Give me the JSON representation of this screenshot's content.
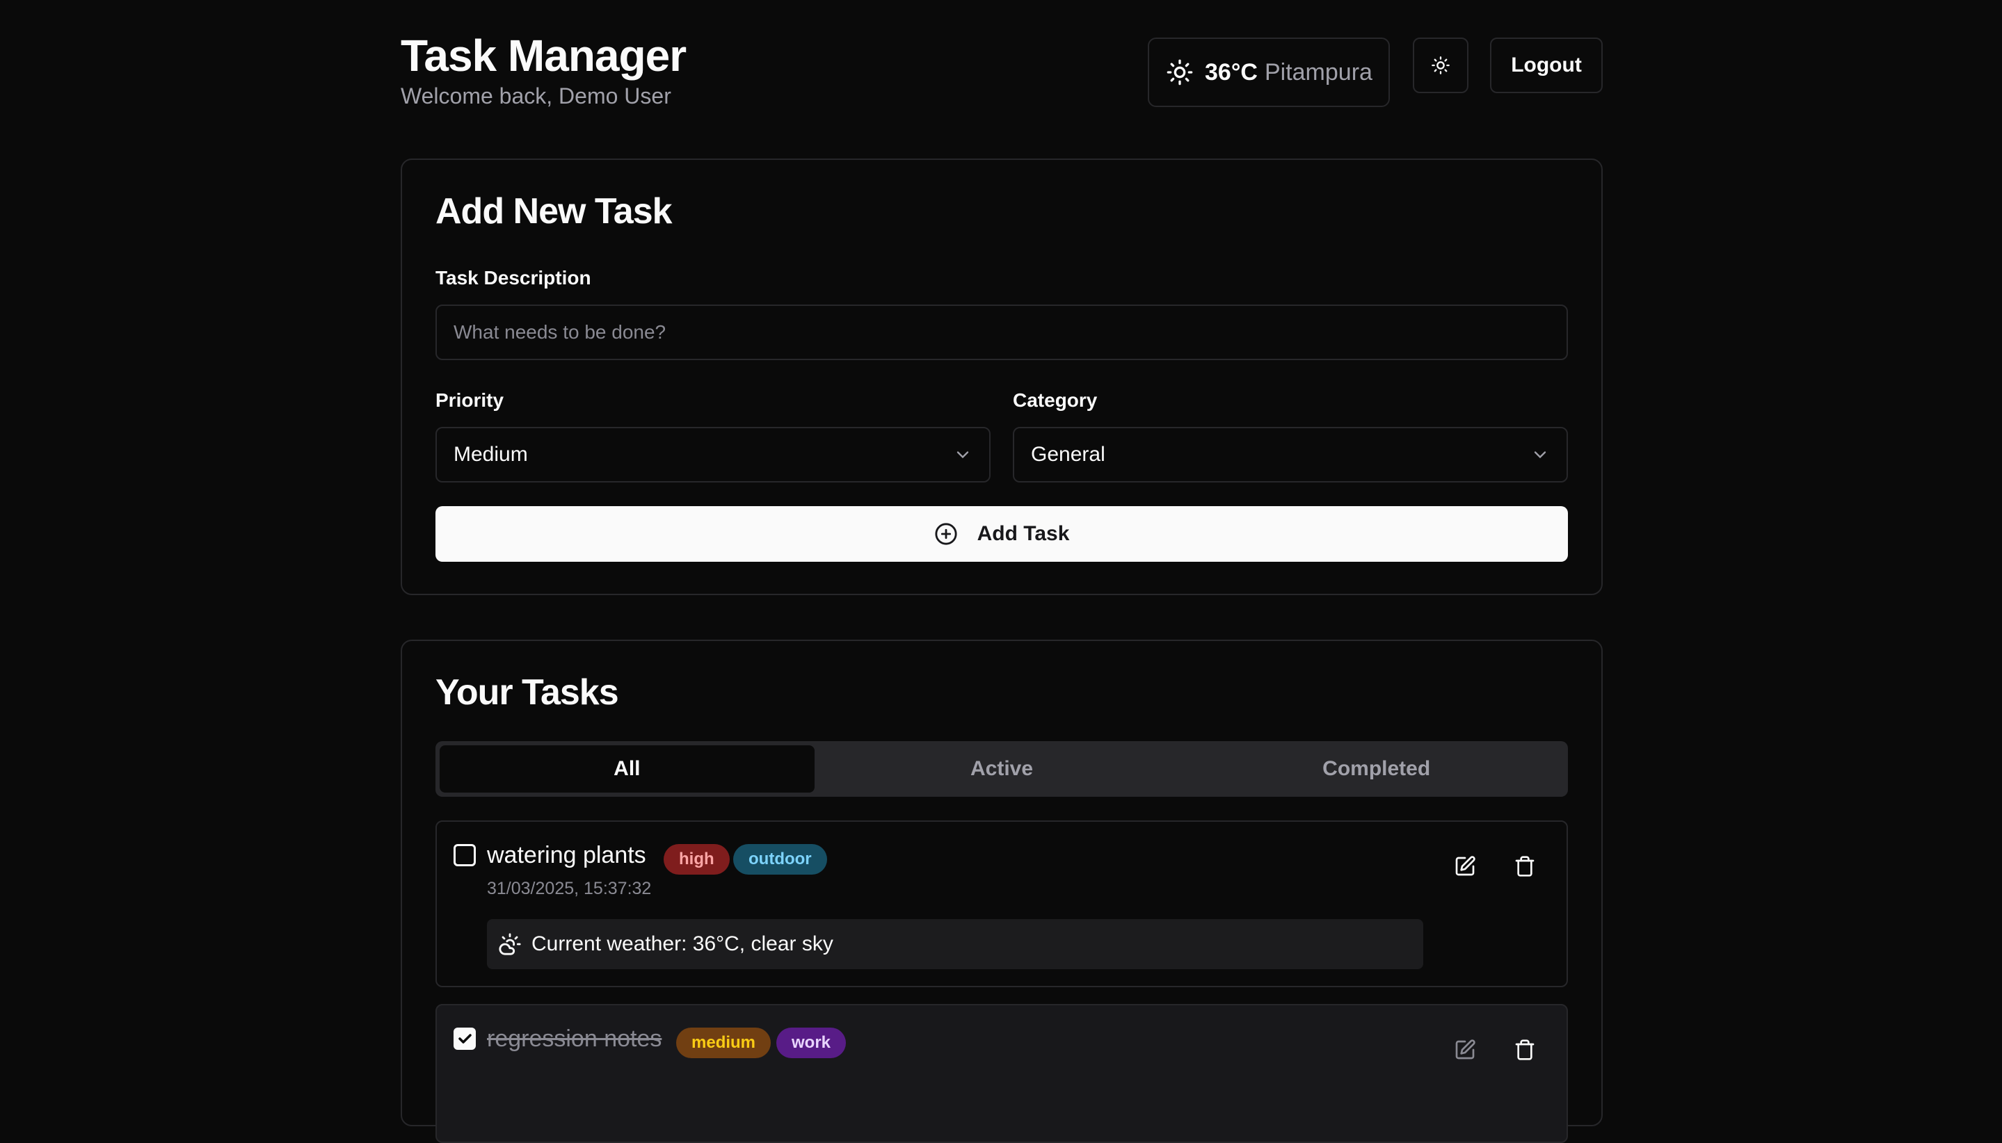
{
  "header": {
    "title": "Task Manager",
    "welcome": "Welcome back, Demo User",
    "weather": {
      "temp": "36°C",
      "city": "Pitampura",
      "icon": "sun-icon"
    },
    "theme_toggle_icon": "sun-icon",
    "logout_label": "Logout"
  },
  "add_task": {
    "title": "Add New Task",
    "description_label": "Task Description",
    "description_placeholder": "What needs to be done?",
    "description_value": "",
    "priority_label": "Priority",
    "priority_value": "Medium",
    "category_label": "Category",
    "category_value": "General",
    "submit_label": "Add Task"
  },
  "tasks": {
    "title": "Your Tasks",
    "tabs": [
      {
        "label": "All",
        "active": true
      },
      {
        "label": "Active",
        "active": false
      },
      {
        "label": "Completed",
        "active": false
      }
    ],
    "items": [
      {
        "title": "watering plants",
        "completed": false,
        "priority": "high",
        "category": "outdoor",
        "timestamp": "31/03/2025, 15:37:32",
        "weather_note": "Current weather: 36°C, clear sky"
      },
      {
        "title": "regression notes",
        "completed": true,
        "priority": "medium",
        "category": "work"
      }
    ]
  },
  "colors": {
    "background": "#0a0a0a",
    "border": "#27272a",
    "badge_high_bg": "#7f1d1d",
    "badge_high_fg": "#fca5a5",
    "badge_outdoor_bg": "#164e63",
    "badge_outdoor_fg": "#7dd3fc",
    "badge_medium_bg": "#713f12",
    "badge_medium_fg": "#facc15",
    "badge_work_bg": "#581c87",
    "badge_work_fg": "#e9d5ff"
  }
}
